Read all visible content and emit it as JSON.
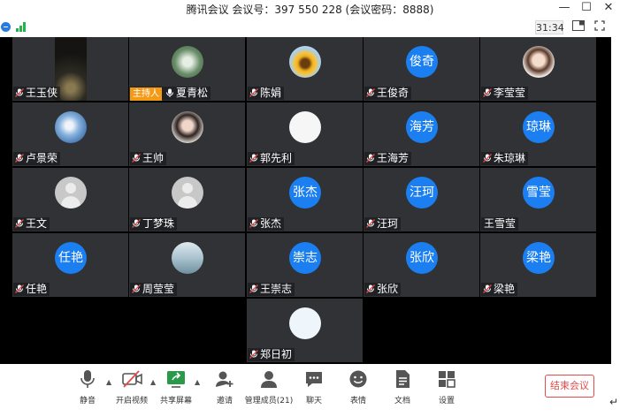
{
  "window": {
    "title": "腾讯会议 会议号：397 550 228  (会议密码：8888)",
    "buttons": {
      "minimize": "—",
      "maximize": "☐",
      "close": "✕"
    }
  },
  "infobar": {
    "timer": "31:34",
    "icons": [
      "security-shield-icon",
      "network-signal-icon",
      "layout-icon",
      "fullscreen-icon"
    ]
  },
  "participants": [
    {
      "name": "王玉侠",
      "avatar": "photo-dark",
      "muted": true
    },
    {
      "name": "夏青松",
      "avatar": "photo-dandelion",
      "muted": false,
      "host": true,
      "host_label": "主持人"
    },
    {
      "name": "陈娟",
      "avatar": "photo-sunflower",
      "muted": true
    },
    {
      "name": "王俊奇",
      "avatar_text": "俊奇",
      "muted": true
    },
    {
      "name": "李莹莹",
      "avatar": "photo-girl",
      "muted": true
    },
    {
      "name": "卢景荣",
      "avatar": "photo-flower",
      "muted": true
    },
    {
      "name": "王帅",
      "avatar": "photo-woman",
      "muted": true
    },
    {
      "name": "郭先利",
      "avatar": "photo-sketch",
      "muted": true
    },
    {
      "name": "王海芳",
      "avatar_text": "海芳",
      "muted": true
    },
    {
      "name": "朱琼琳",
      "avatar_text": "琼琳",
      "muted": true
    },
    {
      "name": "王文",
      "avatar": "gray",
      "muted": true
    },
    {
      "name": "丁梦珠",
      "avatar": "gray",
      "muted": true
    },
    {
      "name": "张杰",
      "avatar_text": "张杰",
      "muted": true
    },
    {
      "name": "汪珂",
      "avatar_text": "汪珂",
      "muted": true
    },
    {
      "name": "王雪莹",
      "avatar_text": "雪莹",
      "muted": false
    },
    {
      "name": "任艳",
      "avatar_text": "任艳",
      "muted": true
    },
    {
      "name": "周莹莹",
      "avatar": "photo-sea",
      "muted": true
    },
    {
      "name": "王崇志",
      "avatar_text": "崇志",
      "muted": true
    },
    {
      "name": "张欣",
      "avatar_text": "张欣",
      "muted": true
    },
    {
      "name": "梁艳",
      "avatar_text": "梁艳",
      "muted": true
    },
    {
      "name": "郑日初",
      "avatar": "photo-baby",
      "muted": true
    }
  ],
  "toolbar": {
    "mute": "静音",
    "video": "开启视频",
    "share": "共享屏幕",
    "invite": "邀请",
    "members": "管理成员(21)",
    "chat": "聊天",
    "reaction": "表情",
    "docs": "文档",
    "settings": "设置",
    "end": "结束会议"
  },
  "colors": {
    "tile_bg": "#303235",
    "grid_bg": "#000000",
    "avatar_blue": "#1b7ff2",
    "host_badge": "#f39a16",
    "end_red": "#e64a4a",
    "mic_muted": "#e04b4b"
  }
}
